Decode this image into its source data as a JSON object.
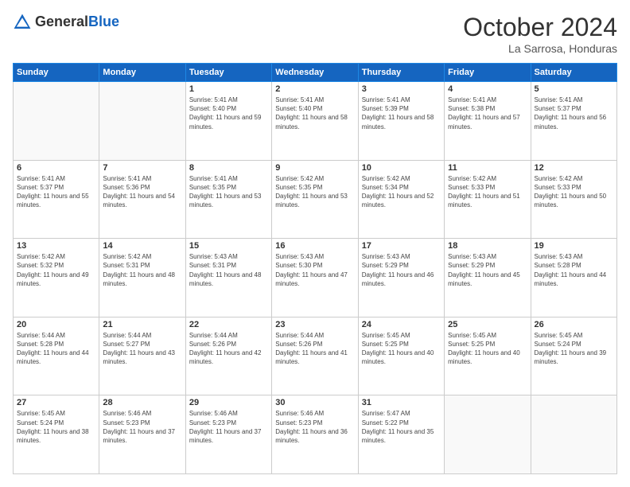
{
  "header": {
    "logo_general": "General",
    "logo_blue": "Blue",
    "title": "October 2024",
    "location": "La Sarrosa, Honduras"
  },
  "days_of_week": [
    "Sunday",
    "Monday",
    "Tuesday",
    "Wednesday",
    "Thursday",
    "Friday",
    "Saturday"
  ],
  "weeks": [
    [
      {
        "num": "",
        "text": ""
      },
      {
        "num": "",
        "text": ""
      },
      {
        "num": "1",
        "text": "Sunrise: 5:41 AM\nSunset: 5:40 PM\nDaylight: 11 hours and 59 minutes."
      },
      {
        "num": "2",
        "text": "Sunrise: 5:41 AM\nSunset: 5:40 PM\nDaylight: 11 hours and 58 minutes."
      },
      {
        "num": "3",
        "text": "Sunrise: 5:41 AM\nSunset: 5:39 PM\nDaylight: 11 hours and 58 minutes."
      },
      {
        "num": "4",
        "text": "Sunrise: 5:41 AM\nSunset: 5:38 PM\nDaylight: 11 hours and 57 minutes."
      },
      {
        "num": "5",
        "text": "Sunrise: 5:41 AM\nSunset: 5:37 PM\nDaylight: 11 hours and 56 minutes."
      }
    ],
    [
      {
        "num": "6",
        "text": "Sunrise: 5:41 AM\nSunset: 5:37 PM\nDaylight: 11 hours and 55 minutes."
      },
      {
        "num": "7",
        "text": "Sunrise: 5:41 AM\nSunset: 5:36 PM\nDaylight: 11 hours and 54 minutes."
      },
      {
        "num": "8",
        "text": "Sunrise: 5:41 AM\nSunset: 5:35 PM\nDaylight: 11 hours and 53 minutes."
      },
      {
        "num": "9",
        "text": "Sunrise: 5:42 AM\nSunset: 5:35 PM\nDaylight: 11 hours and 53 minutes."
      },
      {
        "num": "10",
        "text": "Sunrise: 5:42 AM\nSunset: 5:34 PM\nDaylight: 11 hours and 52 minutes."
      },
      {
        "num": "11",
        "text": "Sunrise: 5:42 AM\nSunset: 5:33 PM\nDaylight: 11 hours and 51 minutes."
      },
      {
        "num": "12",
        "text": "Sunrise: 5:42 AM\nSunset: 5:33 PM\nDaylight: 11 hours and 50 minutes."
      }
    ],
    [
      {
        "num": "13",
        "text": "Sunrise: 5:42 AM\nSunset: 5:32 PM\nDaylight: 11 hours and 49 minutes."
      },
      {
        "num": "14",
        "text": "Sunrise: 5:42 AM\nSunset: 5:31 PM\nDaylight: 11 hours and 48 minutes."
      },
      {
        "num": "15",
        "text": "Sunrise: 5:43 AM\nSunset: 5:31 PM\nDaylight: 11 hours and 48 minutes."
      },
      {
        "num": "16",
        "text": "Sunrise: 5:43 AM\nSunset: 5:30 PM\nDaylight: 11 hours and 47 minutes."
      },
      {
        "num": "17",
        "text": "Sunrise: 5:43 AM\nSunset: 5:29 PM\nDaylight: 11 hours and 46 minutes."
      },
      {
        "num": "18",
        "text": "Sunrise: 5:43 AM\nSunset: 5:29 PM\nDaylight: 11 hours and 45 minutes."
      },
      {
        "num": "19",
        "text": "Sunrise: 5:43 AM\nSunset: 5:28 PM\nDaylight: 11 hours and 44 minutes."
      }
    ],
    [
      {
        "num": "20",
        "text": "Sunrise: 5:44 AM\nSunset: 5:28 PM\nDaylight: 11 hours and 44 minutes."
      },
      {
        "num": "21",
        "text": "Sunrise: 5:44 AM\nSunset: 5:27 PM\nDaylight: 11 hours and 43 minutes."
      },
      {
        "num": "22",
        "text": "Sunrise: 5:44 AM\nSunset: 5:26 PM\nDaylight: 11 hours and 42 minutes."
      },
      {
        "num": "23",
        "text": "Sunrise: 5:44 AM\nSunset: 5:26 PM\nDaylight: 11 hours and 41 minutes."
      },
      {
        "num": "24",
        "text": "Sunrise: 5:45 AM\nSunset: 5:25 PM\nDaylight: 11 hours and 40 minutes."
      },
      {
        "num": "25",
        "text": "Sunrise: 5:45 AM\nSunset: 5:25 PM\nDaylight: 11 hours and 40 minutes."
      },
      {
        "num": "26",
        "text": "Sunrise: 5:45 AM\nSunset: 5:24 PM\nDaylight: 11 hours and 39 minutes."
      }
    ],
    [
      {
        "num": "27",
        "text": "Sunrise: 5:45 AM\nSunset: 5:24 PM\nDaylight: 11 hours and 38 minutes."
      },
      {
        "num": "28",
        "text": "Sunrise: 5:46 AM\nSunset: 5:23 PM\nDaylight: 11 hours and 37 minutes."
      },
      {
        "num": "29",
        "text": "Sunrise: 5:46 AM\nSunset: 5:23 PM\nDaylight: 11 hours and 37 minutes."
      },
      {
        "num": "30",
        "text": "Sunrise: 5:46 AM\nSunset: 5:23 PM\nDaylight: 11 hours and 36 minutes."
      },
      {
        "num": "31",
        "text": "Sunrise: 5:47 AM\nSunset: 5:22 PM\nDaylight: 11 hours and 35 minutes."
      },
      {
        "num": "",
        "text": ""
      },
      {
        "num": "",
        "text": ""
      }
    ]
  ]
}
